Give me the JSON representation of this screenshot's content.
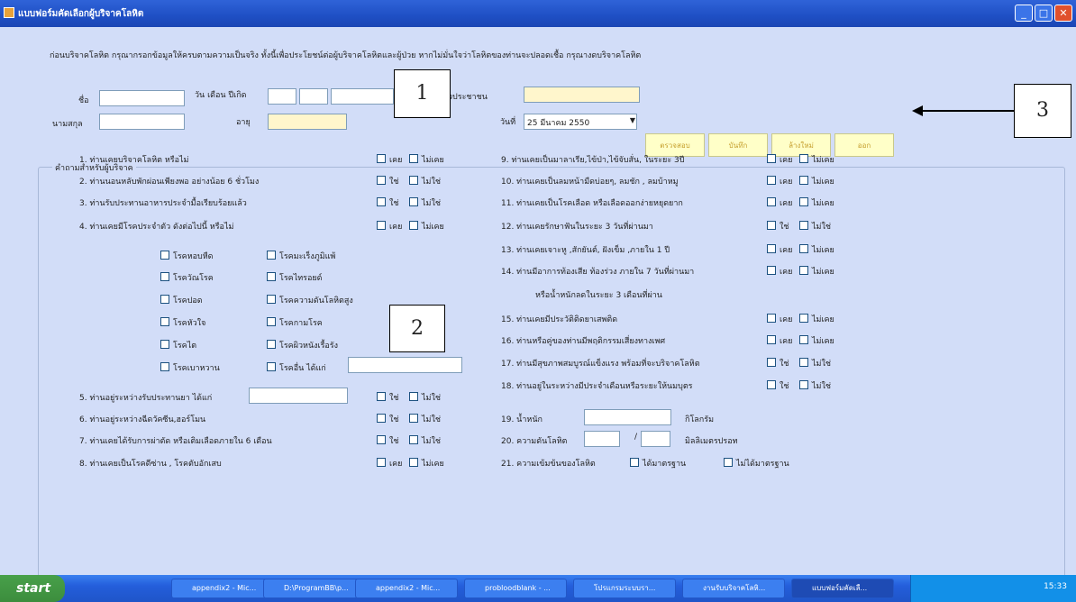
{
  "window": {
    "title": "แบบฟอร์มคัดเลือกผู้บริจาคโลหิต"
  },
  "form": {
    "intro": "ก่อนบริจาคโลหิต กรุณากรอกข้อมูลให้ครบตามความเป็นจริง ทั้งนี้เพื่อประโยชน์ต่อผู้บริจาคโลหิตและผู้ป่วย หากไม่มั่นใจว่าโลหิตของท่านจะปลอดเชื้อ กรุณางดบริจาคโลหิต",
    "name_label": "ชื่อ",
    "surname_label": "นามสกุล",
    "dob_label": "วัน เดือน ปีเกิด",
    "age_label": "อายุ",
    "id_label": "วประชาชน",
    "date_label": "วันที่",
    "date_value": "25  มีนาคม   2550",
    "buttons": [
      "ตรวจสอบ",
      "บันทึก",
      "ล้างใหม่",
      "ออก"
    ],
    "group_title": "คำถามสำหรับผู้บริจาค"
  },
  "questions_left": [
    {
      "text": "1. ท่านเคยบริจาคโลหิต หรือไม่",
      "opt1": "เคย",
      "opt2": "ไม่เคย"
    },
    {
      "text": "2. ท่านนอนหลับพักผ่อนเพียงพอ อย่างน้อย 6 ชั่วโมง",
      "opt1": "ใช่",
      "opt2": "ไม่ใช่"
    },
    {
      "text": "3. ท่านรับประทานอาหารประจำมื้อเรียบร้อยแล้ว",
      "opt1": "ใช่",
      "opt2": "ไม่ใช่"
    },
    {
      "text": "4. ท่านเคยมีโรคประจำตัว ดังต่อไปนี้ หรือไม่",
      "opt1": "เคย",
      "opt2": "ไม่เคย"
    }
  ],
  "diseases": [
    [
      "โรคหอบหืด",
      "โรคมะเร็งภูมิแพ้"
    ],
    [
      "โรควัณโรค",
      "โรคไทรอยด์"
    ],
    [
      "โรคปอด",
      "โรคความดันโลหิตสูง"
    ],
    [
      "โรคหัวใจ",
      "โรคกามโรค"
    ],
    [
      "โรคไต",
      "โรคผิวหนังเรื้อรัง"
    ],
    [
      "โรคเบาหวาน",
      "โรคอื่น ได้แก่"
    ]
  ],
  "questions_left2": [
    {
      "text": "5. ท่านอยู่ระหว่างรับประทานยา ได้แก่",
      "opt1": "ใช่",
      "opt2": "ไม่ใช่"
    },
    {
      "text": "6. ท่านอยู่ระหว่างฉีดวัคซีน,ฮอร์โมน",
      "opt1": "ใช่",
      "opt2": "ไม่ใช่"
    },
    {
      "text": "7. ท่านเคยได้รับการผ่าตัด หรือเติมเลือดภายใน  6 เดือน",
      "opt1": "ใช่",
      "opt2": "ไม่ใช่"
    },
    {
      "text": "8. ท่านเคยเป็นโรคดีซ่าน , โรคตับอักเสบ",
      "opt1": "เคย",
      "opt2": "ไม่เคย"
    }
  ],
  "questions_right": [
    {
      "text": "9. ท่านเคยเป็นมาลาเรีย,ไข้ป่า,ไข้จับสั่น, ในระยะ 3ปี",
      "opt1": "เคย",
      "opt2": "ไม่เคย"
    },
    {
      "text": "10. ท่านเคยเป็นลมหน้ามืดบ่อยๆ, ลมชัก , ลมบ้าหมู",
      "opt1": "เคย",
      "opt2": "ไม่เคย"
    },
    {
      "text": "11. ท่านเคยเป็นโรคเลือด หรือเลือดออกง่ายหยุดยาก",
      "opt1": "เคย",
      "opt2": "ไม่เคย"
    },
    {
      "text": "12. ท่านเคยรักษาฟันในระยะ 3 วันที่ผ่านมา",
      "opt1": "ใช่",
      "opt2": "ไม่ใช่"
    },
    {
      "text": "13. ท่านเคยเจาะหู ,สักยันต์, ฝังเข็ม ,ภายใน 1 ปี",
      "opt1": "เคย",
      "opt2": "ไม่เคย"
    },
    {
      "text": "14. ท่านมีอาการท้องเสีย ท้องร่วง ภายใน 7 วันที่ผ่านมา",
      "opt1": "เคย",
      "opt2": "ไม่เคย"
    },
    {
      "text": "หรือน้ำหนักลดในระยะ 3 เดือนที่ผ่าน"
    },
    {
      "text": "15. ท่านเคยมีประวัติติดยาเสพติด",
      "opt1": "เคย",
      "opt2": "ไม่เคย"
    },
    {
      "text": "16. ท่านหรือคู่ของท่านมีพฤติกรรมเสี่ยงทางเพศ",
      "opt1": "เคย",
      "opt2": "ไม่เคย"
    },
    {
      "text": "17. ท่านมีสุขภาพสมบูรณ์แข็งแรง พร้อมที่จะบริจาคโลหิต",
      "opt1": "ใช่",
      "opt2": "ไม่ใช่"
    },
    {
      "text": "18. ท่านอยู่ในระหว่างมีประจำเดือนหรือระยะให้นมบุตร",
      "opt1": "ใช่",
      "opt2": "ไม่ใช่"
    }
  ],
  "weight": {
    "label": "19. น้ำหนัก",
    "unit": "กิโลกรัม"
  },
  "pressure": {
    "label": "20. ความดันโลหิต",
    "sep": "/",
    "unit": "มิลลิเมตรปรอท"
  },
  "density": {
    "label": "21. ความเข้มข้นของโลหิต",
    "opt1": "ได้มาตรฐาน",
    "opt2": "ไม่ได้มาตรฐาน"
  },
  "annotations": [
    "1",
    "2",
    "3"
  ],
  "taskbar": {
    "start": "start",
    "items": [
      "appendix2 - Mic...",
      "D:\\ProgramBB\\p...",
      "appendix2 - Mic...",
      "probloodblank - ...",
      "โปรแกรมระบบรา...",
      "งานรับบริจาคโลหิ...",
      "แบบฟอร์มคัดเลื..."
    ],
    "clock": "15:33"
  }
}
